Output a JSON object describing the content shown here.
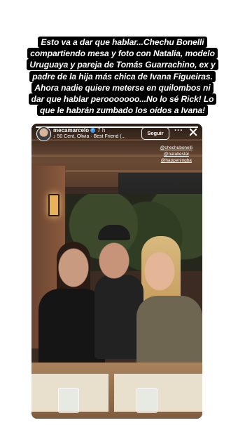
{
  "caption": {
    "lines": [
      "Esto va a dar que hablar...Chechu Bonelli",
      "compartiendo mesa y foto con Natalia, modelo",
      "Uruguaya y pareja de Tomás Guarrachino, ex y",
      "padre de la hija más chica de Ivana Figueiras.",
      "Ahora nadie quiere meterse en quilombos ni",
      "dar que hablar perooooooo...No lo sé Rick! Lo",
      "que le habrán zumbado los oídos a Ivana!"
    ]
  },
  "story": {
    "username": "mecamarcelo",
    "time_ago": "7 h",
    "music": "♪ 50 Cent, Olivia · Best Friend (...",
    "follow_label": "Seguir",
    "more_label": "···",
    "progress": 1.0,
    "tags": [
      "@chechubonelli",
      "@nataliestal",
      "@happeningba"
    ]
  }
}
